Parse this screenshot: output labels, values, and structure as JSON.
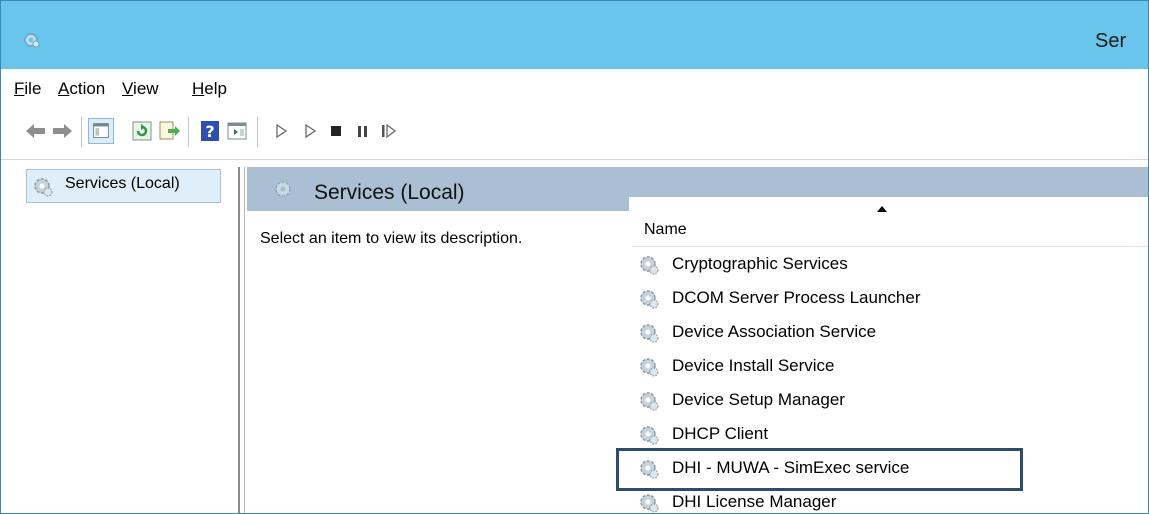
{
  "window": {
    "title": "Ser"
  },
  "menu": [
    {
      "label": "File"
    },
    {
      "label": "Action"
    },
    {
      "label": "View"
    },
    {
      "label": "Help"
    }
  ],
  "toolbar": {
    "icons": [
      "back-icon",
      "forward-icon",
      "show-hide-console-tree-icon",
      "refresh-icon",
      "export-list-icon",
      "help-icon",
      "properties-pane-icon",
      "start-service-icon",
      "start-service-alt-icon",
      "stop-service-icon",
      "pause-service-icon",
      "resume-service-icon"
    ]
  },
  "tree": {
    "selected_label": "Services (Local)"
  },
  "detail": {
    "title": "Services (Local)",
    "description_prompt": "Select an item to view its description.",
    "column_name": "Name",
    "services": [
      {
        "name": "Cryptographic Services"
      },
      {
        "name": "DCOM Server Process Launcher"
      },
      {
        "name": "Device Association Service"
      },
      {
        "name": "Device Install Service"
      },
      {
        "name": "Device Setup Manager"
      },
      {
        "name": "DHCP Client"
      },
      {
        "name": "DHI - MUWA - SimExec service"
      },
      {
        "name": "DHI License Manager"
      }
    ]
  },
  "colors": {
    "titlebar": "#69c5eb",
    "detail_header": "#aabfd4",
    "highlight_border": "#2d4c6d"
  }
}
